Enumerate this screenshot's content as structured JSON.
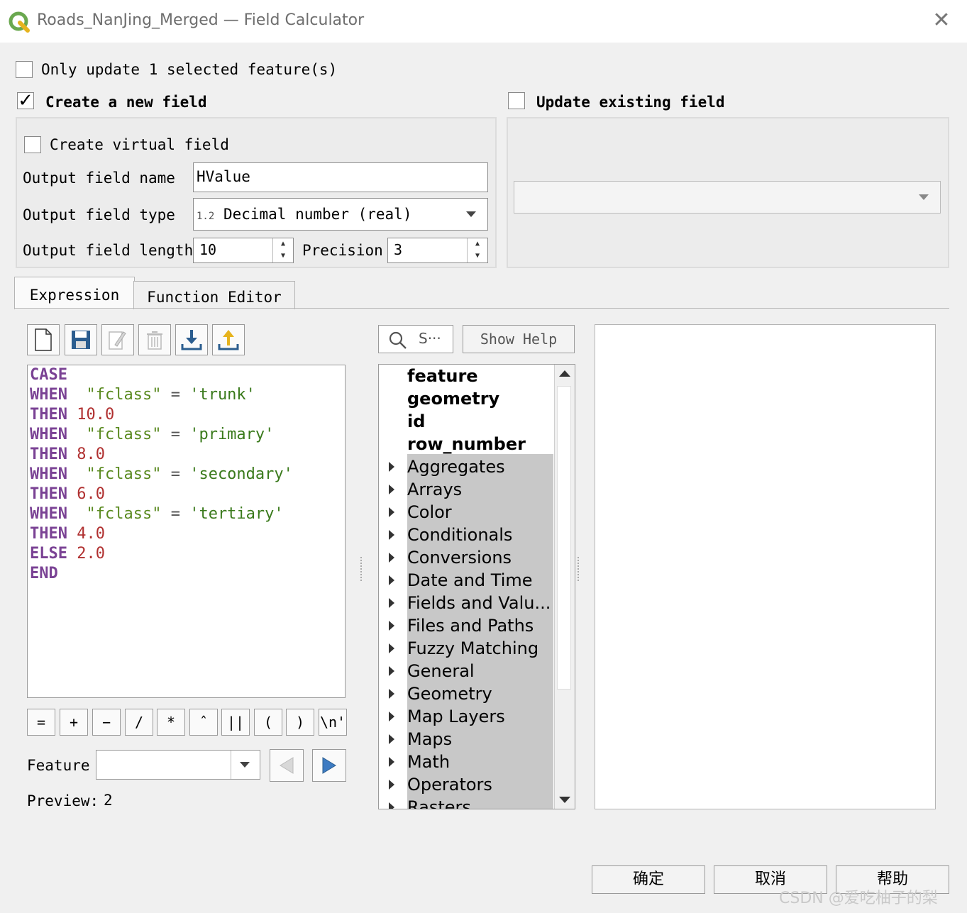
{
  "window": {
    "title": "Roads_NanJing_Merged — Field Calculator",
    "close_glyph": "✕"
  },
  "options": {
    "only_selected_label": "Only update 1 selected feature(s)",
    "create_new_field_label": "Create a new field",
    "update_existing_label": "Update existing field",
    "create_virtual_label": "Create virtual field"
  },
  "new_field": {
    "name_label": "Output field name",
    "name_value": "HValue",
    "type_label": "Output field type",
    "type_icon": "1.2",
    "type_value": "Decimal number (real)",
    "length_label": "Output field length",
    "length_value": "10",
    "precision_label": "Precision",
    "precision_value": "3"
  },
  "tabs": [
    {
      "label": "Expression",
      "active": true
    },
    {
      "label": "Function Editor",
      "active": false
    }
  ],
  "search": {
    "placeholder": "S···"
  },
  "show_help_label": "Show Help",
  "operators": [
    "=",
    "+",
    "−",
    "/",
    "*",
    "ˆ",
    "||",
    "(",
    ")",
    "\\n'"
  ],
  "feature_label": "Feature",
  "preview_label": "Preview:",
  "preview_value": "2",
  "expression_lines": [
    [
      {
        "t": "CASE",
        "c": "kw"
      }
    ],
    [
      {
        "t": "WHEN",
        "c": "kw"
      },
      {
        "t": "  "
      },
      {
        "t": "\"fclass\"",
        "c": "fld"
      },
      {
        "t": " = ",
        "c": "op"
      },
      {
        "t": "'trunk'",
        "c": "str"
      }
    ],
    [
      {
        "t": "THEN",
        "c": "kw"
      },
      {
        "t": " "
      },
      {
        "t": "10.0",
        "c": "num"
      }
    ],
    [
      {
        "t": "WHEN",
        "c": "kw"
      },
      {
        "t": "  "
      },
      {
        "t": "\"fclass\"",
        "c": "fld"
      },
      {
        "t": " = ",
        "c": "op"
      },
      {
        "t": "'primary'",
        "c": "str"
      }
    ],
    [
      {
        "t": "THEN",
        "c": "kw"
      },
      {
        "t": " "
      },
      {
        "t": "8.0",
        "c": "num"
      }
    ],
    [
      {
        "t": "WHEN",
        "c": "kw"
      },
      {
        "t": "  "
      },
      {
        "t": "\"fclass\"",
        "c": "fld"
      },
      {
        "t": " = ",
        "c": "op"
      },
      {
        "t": "'secondary'",
        "c": "str"
      }
    ],
    [
      {
        "t": "THEN",
        "c": "kw"
      },
      {
        "t": " "
      },
      {
        "t": "6.0",
        "c": "num"
      }
    ],
    [
      {
        "t": "WHEN",
        "c": "kw"
      },
      {
        "t": "  "
      },
      {
        "t": "\"fclass\"",
        "c": "fld"
      },
      {
        "t": " = ",
        "c": "op"
      },
      {
        "t": "'tertiary'",
        "c": "str"
      }
    ],
    [
      {
        "t": "THEN",
        "c": "kw"
      },
      {
        "t": " "
      },
      {
        "t": "4.0",
        "c": "num"
      }
    ],
    [
      {
        "t": "ELSE",
        "c": "kw"
      },
      {
        "t": " "
      },
      {
        "t": "2.0",
        "c": "num"
      }
    ],
    [
      {
        "t": "END",
        "c": "kw"
      }
    ]
  ],
  "function_tree": {
    "top_items": [
      "feature",
      "geometry",
      "id",
      "row_number"
    ],
    "groups": [
      "Aggregates",
      "Arrays",
      "Color",
      "Conditionals",
      "Conversions",
      "Date and Time",
      "Fields and Valu...",
      "Files and Paths",
      "Fuzzy Matching",
      "General",
      "Geometry",
      "Map Layers",
      "Maps",
      "Math",
      "Operators",
      "Rasters"
    ]
  },
  "dialog_buttons": {
    "ok": "确定",
    "cancel": "取消",
    "help": "帮助"
  },
  "watermark": "CSDN @爱吃柚子的梨"
}
